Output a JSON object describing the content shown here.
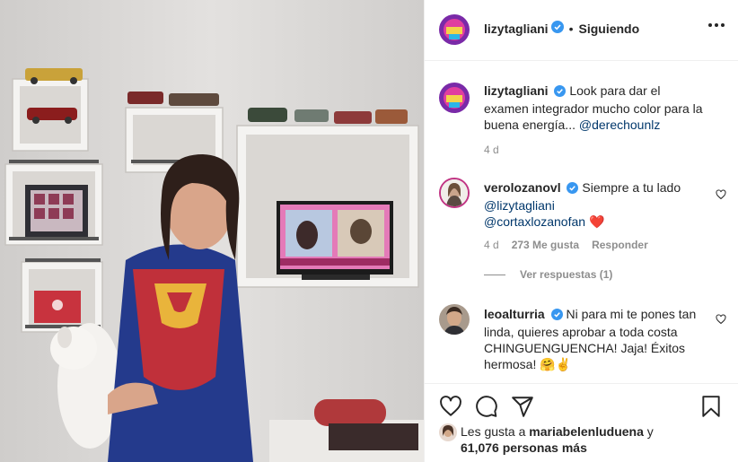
{
  "post": {
    "author": "lizytagliani",
    "follow_status": "Siguiendo",
    "separator": "•"
  },
  "caption": {
    "username": "lizytagliani",
    "text": "Look para dar el examen integrador mucho color para la buena energía... ",
    "mention": "@derechounlz",
    "time": "4 d"
  },
  "comments": [
    {
      "username": "verolozanovl",
      "text": "Siempre a tu lado ",
      "mention1": "@lizytagliani",
      "mention2": "@cortaxlozanofan",
      "emoji": "❤️",
      "time": "4 d",
      "likes": "273 Me gusta",
      "reply_label": "Responder",
      "view_replies": "Ver respuestas (1)"
    },
    {
      "username": "leoalturria",
      "text": "Ni para mi te pones tan linda, quieres aprobar a toda costa CHINGUENGUENCHA! Jaja! Éxitos hermosa!",
      "emoji": "🤗✌️"
    }
  ],
  "likes_summary": {
    "prefix": "Les gusta a ",
    "user": "mariabelenluduena",
    "middle": " y",
    "count": "61,076 personas más"
  },
  "icons": {
    "like": "heart-icon",
    "comment": "comment-icon",
    "share": "share-icon",
    "save": "bookmark-icon",
    "more": "more-options-icon",
    "verified": "verified-badge-icon"
  },
  "colors": {
    "verified": "#3897f0",
    "heart": "#ed4956",
    "link": "#00376b",
    "meta": "#8e8e8e"
  }
}
